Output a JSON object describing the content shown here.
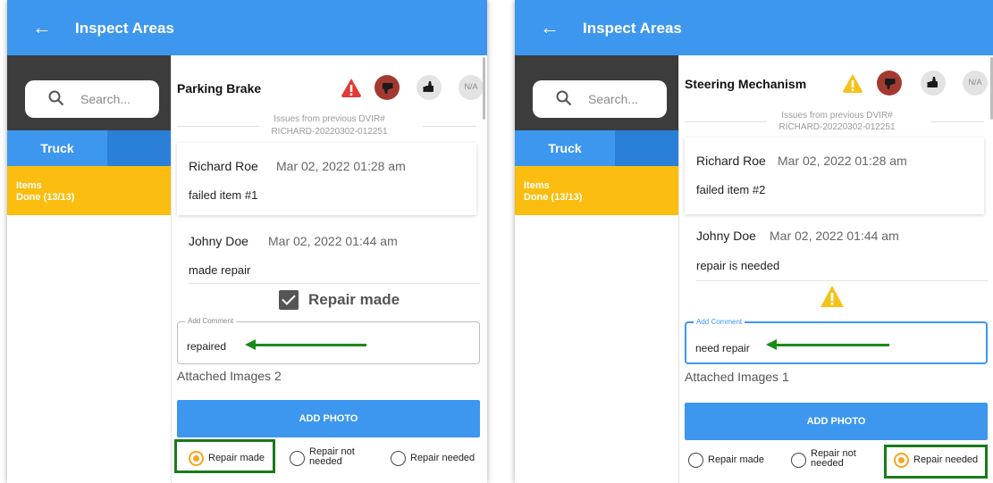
{
  "colors": {
    "app_bar": "#3d97ee",
    "items_done": "#fbbd0f",
    "sidebar_dark": "#3c3c3c",
    "failed_active": "#a33a32",
    "warning": "#f5c21b",
    "danger": "#e53935",
    "annotation_green": "#1a8a1a"
  },
  "left": {
    "header": {
      "back_icon": "←",
      "title": "Inspect Areas"
    },
    "search": {
      "placeholder": "Search..."
    },
    "tabs": {
      "truck": "Truck"
    },
    "items": {
      "line1": "Items",
      "line2": "Done (13/13)"
    },
    "item_title": "Parking Brake",
    "na_label": "N/A",
    "previous": {
      "line1": "Issues from previous DVIR#",
      "line2": "RICHARD-20220302-012251"
    },
    "entry1": {
      "name": "Richard Roe",
      "date": "Mar 02, 2022  01:28 am",
      "text": "failed item #1"
    },
    "entry2": {
      "name": "Johny Doe",
      "date": "Mar 02, 2022  01:44 am",
      "text": "made repair"
    },
    "repair_made_label": "Repair made",
    "comment": {
      "legend": "Add Comment",
      "value": "repaired"
    },
    "attached_images": "Attached Images 2",
    "add_photo": "ADD PHOTO",
    "radios": {
      "opt1": "Repair made",
      "opt2a": "Repair not",
      "opt2b": "needed",
      "opt3": "Repair needed",
      "selected": "Repair made"
    }
  },
  "right": {
    "header": {
      "back_icon": "←",
      "title": "Inspect Areas"
    },
    "search": {
      "placeholder": "Search..."
    },
    "tabs": {
      "truck": "Truck"
    },
    "items": {
      "line1": "Items",
      "line2": "Done (13/13)"
    },
    "item_title": "Steering Mechanism",
    "na_label": "N/A",
    "previous": {
      "line1": "Issues from previous DVIR#",
      "line2": "RICHARD-20220302-012251"
    },
    "entry1": {
      "name": "Richard Roe",
      "date": "Mar 02, 2022  01:28 am",
      "text": "failed item #2"
    },
    "entry2": {
      "name": "Johny Doe",
      "date": "Mar 02, 2022  01:44 am",
      "text": "repair is needed"
    },
    "comment": {
      "legend": "Add Comment",
      "value": "need repair"
    },
    "attached_images": "Attached Images 1",
    "add_photo": "ADD PHOTO",
    "radios": {
      "opt1": "Repair made",
      "opt2a": "Repair not",
      "opt2b": "needed",
      "opt3": "Repair needed",
      "selected": "Repair needed"
    }
  }
}
